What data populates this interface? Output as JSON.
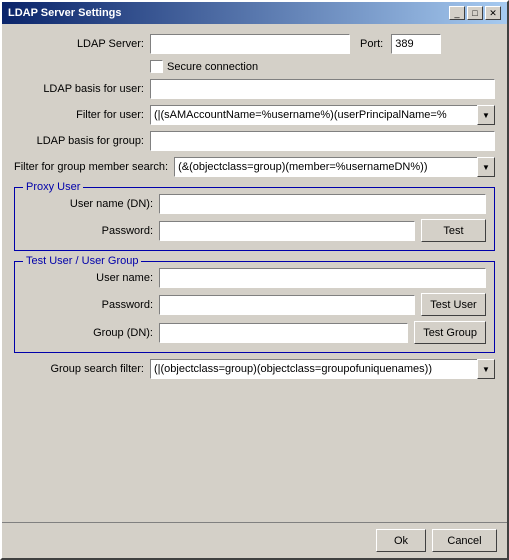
{
  "window": {
    "title": "LDAP Server Settings",
    "close_btn": "✕",
    "maximize_btn": "□",
    "minimize_btn": "_"
  },
  "form": {
    "ldap_server_label": "LDAP Server:",
    "ldap_server_value": "",
    "port_label": "Port:",
    "port_value": "389",
    "secure_connection_label": "Secure connection",
    "ldap_basis_user_label": "LDAP basis for user:",
    "ldap_basis_user_value": "",
    "filter_user_label": "Filter for user:",
    "filter_user_value": "(|(sAMAccountName=%username%)(userPrincipalName=%",
    "filter_user_dropdown_arrow": "▼",
    "ldap_basis_group_label": "LDAP basis for group:",
    "ldap_basis_group_value": "",
    "filter_group_label": "Filter for group member search:",
    "filter_group_value": "(&(objectclass=group)(member=%usernameDN%))",
    "filter_group_dropdown_arrow": "▼",
    "proxy_user_section": "Proxy User",
    "username_dn_label": "User name (DN):",
    "username_dn_value": "",
    "password_label": "Password:",
    "password_value": "",
    "test_btn": "Test",
    "test_user_section": "Test User / User Group",
    "test_username_label": "User name:",
    "test_username_value": "",
    "test_password_label": "Password:",
    "test_password_value": "",
    "test_user_btn": "Test User",
    "group_dn_label": "Group (DN):",
    "group_dn_value": "",
    "test_group_btn": "Test Group",
    "group_search_filter_label": "Group search filter:",
    "group_search_filter_value": "(|(objectclass=group)(objectclass=groupofuniquenames))",
    "group_search_dropdown_arrow": "▼",
    "ok_btn": "Ok",
    "cancel_btn": "Cancel"
  }
}
